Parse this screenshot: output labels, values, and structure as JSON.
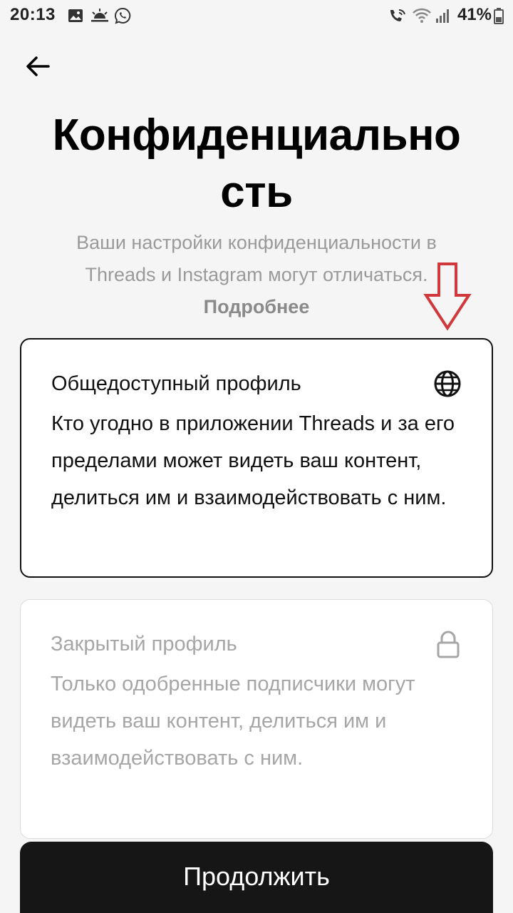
{
  "status_bar": {
    "time": "20:13",
    "battery_percent": "41%",
    "left_icons": [
      "gallery-icon",
      "sunrise-icon",
      "viber-icon"
    ],
    "right_icons": [
      "wifi-calling-icon",
      "wifi-icon",
      "signal-icon",
      "battery-icon"
    ]
  },
  "header": {
    "back_icon": "arrow-left-icon",
    "title": "Конфиденциальность"
  },
  "subtitle": {
    "text": "Ваши настройки конфиденциальности в Threads и Instagram могут отличаться. ",
    "link": "Подробнее"
  },
  "options": {
    "public": {
      "title": "Общедоступный профиль",
      "description": "Кто угодно в приложении Threads и за его пределами может видеть ваш контент, делиться им и взаимодействовать с ним.",
      "icon": "globe-icon",
      "selected": true
    },
    "private": {
      "title": "Закрытый профиль",
      "description": "Только одобренные подписчики могут видеть ваш контент, делиться им и взаимодействовать с ним.",
      "icon": "lock-icon",
      "selected": false
    }
  },
  "continue_label": "Продолжить",
  "colors": {
    "background": "#f5f5f5",
    "button": "#161616",
    "annotation_arrow": "#d0383b",
    "muted_text": "#a6a6a6"
  }
}
